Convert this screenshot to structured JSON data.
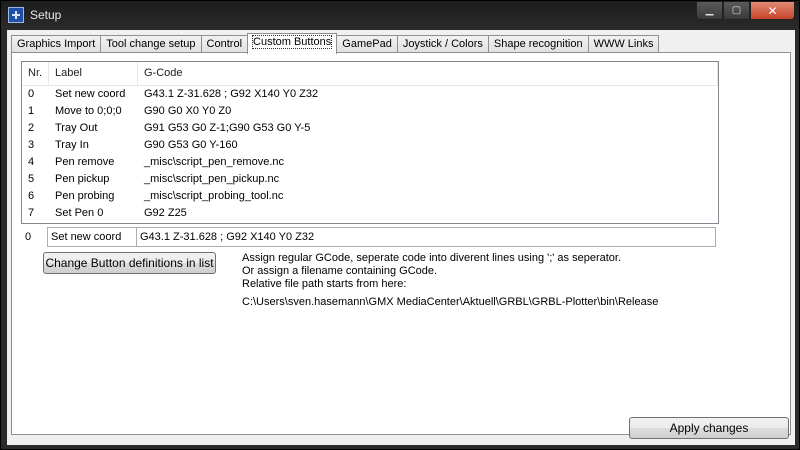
{
  "window": {
    "title": "Setup"
  },
  "tabs": [
    {
      "label": "Graphics Import"
    },
    {
      "label": "Tool change setup"
    },
    {
      "label": "Control"
    },
    {
      "label": "Custom Buttons"
    },
    {
      "label": "GamePad"
    },
    {
      "label": "Joystick / Colors"
    },
    {
      "label": "Shape recognition"
    },
    {
      "label": "WWW Links"
    }
  ],
  "active_tab": "Custom Buttons",
  "list": {
    "headers": {
      "nr": "Nr.",
      "label": "Label",
      "gcode": "G-Code"
    },
    "rows": [
      {
        "nr": "0",
        "label": "Set new coord",
        "gcode": "G43.1 Z-31.628 ; G92 X140 Y0 Z32"
      },
      {
        "nr": "1",
        "label": "Move to 0;0;0",
        "gcode": "G90 G0 X0 Y0 Z0"
      },
      {
        "nr": "2",
        "label": "Tray Out",
        "gcode": "G91 G53 G0 Z-1;G90 G53 G0 Y-5"
      },
      {
        "nr": "3",
        "label": "Tray In",
        "gcode": "G90 G53 G0 Y-160"
      },
      {
        "nr": "4",
        "label": "Pen remove",
        "gcode": "_misc\\script_pen_remove.nc"
      },
      {
        "nr": "5",
        "label": "Pen pickup",
        "gcode": "_misc\\script_pen_pickup.nc"
      },
      {
        "nr": "6",
        "label": "Pen probing",
        "gcode": "_misc\\script_probing_tool.nc"
      },
      {
        "nr": "7",
        "label": "Set Pen 0",
        "gcode": "G92 Z25"
      }
    ]
  },
  "edit": {
    "nr": "0",
    "label_value": "Set new coord",
    "gcode_value": "G43.1 Z-31.628 ; G92 X140 Y0 Z32"
  },
  "buttons": {
    "change_definitions": "Change Button definitions in list",
    "apply": "Apply changes"
  },
  "hint": {
    "line1": "Assign regular GCode, seperate code into diverent lines using ';' as seperator.",
    "line2": "Or assign a filename containing GCode.",
    "line3": "Relative file path starts from here:",
    "path": "C:\\Users\\sven.hasemann\\GMX MediaCenter\\Aktuell\\GRBL\\GRBL-Plotter\\bin\\Release"
  }
}
